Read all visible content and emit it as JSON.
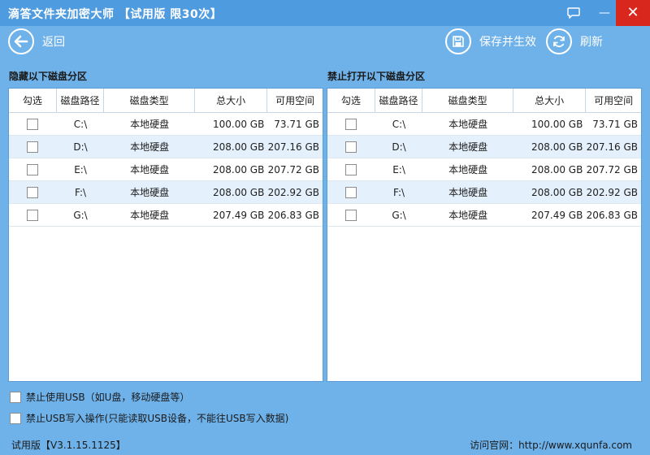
{
  "window": {
    "title": "滴答文件夹加密大师 【试用版 限30次】",
    "close_glyph": "✕",
    "minimize_glyph": "—"
  },
  "toolbar": {
    "back_label": "返回",
    "save_label": "保存并生效",
    "refresh_label": "刷新"
  },
  "left_panel": {
    "title": "隐藏以下磁盘分区",
    "columns": [
      "勾选",
      "磁盘路径",
      "磁盘类型",
      "总大小",
      "可用空间"
    ],
    "rows": [
      {
        "path": "C:\\",
        "type": "本地硬盘",
        "total": "100.00 GB",
        "free": "73.71 GB"
      },
      {
        "path": "D:\\",
        "type": "本地硬盘",
        "total": "208.00 GB",
        "free": "207.16 GB"
      },
      {
        "path": "E:\\",
        "type": "本地硬盘",
        "total": "208.00 GB",
        "free": "207.72 GB"
      },
      {
        "path": "F:\\",
        "type": "本地硬盘",
        "total": "208.00 GB",
        "free": "202.92 GB"
      },
      {
        "path": "G:\\",
        "type": "本地硬盘",
        "total": "207.49 GB",
        "free": "206.83 GB"
      }
    ]
  },
  "right_panel": {
    "title": "禁止打开以下磁盘分区",
    "columns": [
      "勾选",
      "磁盘路径",
      "磁盘类型",
      "总大小",
      "可用空间"
    ],
    "rows": [
      {
        "path": "C:\\",
        "type": "本地硬盘",
        "total": "100.00 GB",
        "free": "73.71 GB"
      },
      {
        "path": "D:\\",
        "type": "本地硬盘",
        "total": "208.00 GB",
        "free": "207.16 GB"
      },
      {
        "path": "E:\\",
        "type": "本地硬盘",
        "total": "208.00 GB",
        "free": "207.72 GB"
      },
      {
        "path": "F:\\",
        "type": "本地硬盘",
        "total": "208.00 GB",
        "free": "202.92 GB"
      },
      {
        "path": "G:\\",
        "type": "本地硬盘",
        "total": "207.49 GB",
        "free": "206.83 GB"
      }
    ]
  },
  "options": {
    "usb_block_label": "禁止使用USB（如U盘，移动硬盘等）",
    "usb_write_label": "禁止USB写入操作(只能读取USB设备，不能往USB写入数据)"
  },
  "footer": {
    "version": "试用版【V3.1.15.1125】",
    "website": "访问官网：http://www.xqunfa.com"
  },
  "colors": {
    "background": "#6fb2ea",
    "titlebar": "#4f9be0",
    "close_button": "#d8271c",
    "row_alt": "#e4f0fb"
  },
  "icons": {
    "back": "arrow-left-icon",
    "save": "floppy-disk-icon",
    "refresh": "refresh-icon",
    "feedback": "chat-bubble-icon",
    "minimize": "minimize-icon",
    "close": "close-icon"
  }
}
